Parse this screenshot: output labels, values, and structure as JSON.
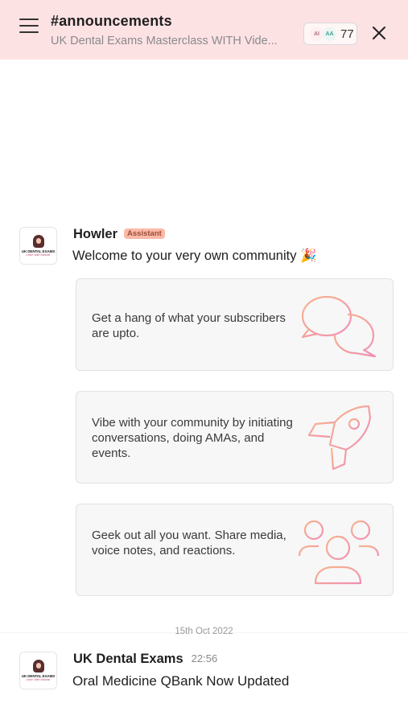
{
  "header": {
    "channel_title": "#announcements",
    "community_name": "UK Dental Exams Masterclass WITH Vide...",
    "member_avatars": [
      "AI",
      "AA"
    ],
    "member_count": "77"
  },
  "welcome_message": {
    "sender": "Howler",
    "badge": "Assistant",
    "text": "Welcome to your very own community 🎉"
  },
  "cards": [
    {
      "text": "Get a hang of what your subscribers are upto.",
      "icon": "chat-bubbles-icon"
    },
    {
      "text": "Vibe with your community by initiating conversations, doing AMAs, and events.",
      "icon": "rocket-icon"
    },
    {
      "text": "Geek out all you want. Share media, voice notes, and reactions.",
      "icon": "people-group-icon"
    }
  ],
  "date_separator": "15th Oct 2022",
  "post": {
    "sender": "UK Dental Exams",
    "time": "22:56",
    "text": "Oral Medicine QBank Now Updated"
  },
  "avatar_logo": {
    "title": "UK DENTAL EXAMS",
    "subtitle": "Learn With Niloofar"
  },
  "colors": {
    "header_bg": "#fde2e4",
    "icon_gradient_start": "#f7b58a",
    "icon_gradient_end": "#f08fb3",
    "badge_bg": "#fbb9a6"
  }
}
